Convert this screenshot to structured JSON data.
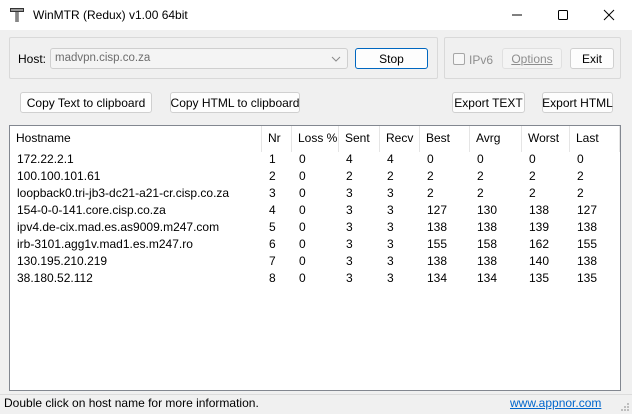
{
  "window": {
    "title": "WinMTR (Redux) v1.00 64bit"
  },
  "toolbar": {
    "host_label": "Host:",
    "host_value": "madvpn.cisp.co.za",
    "stop_label": "Stop",
    "ipv6_label": "IPv6",
    "ipv6_checked": false,
    "options_label": "Options",
    "exit_label": "Exit",
    "copy_text_label": "Copy Text to clipboard",
    "copy_html_label": "Copy HTML to clipboard",
    "export_text_label": "Export TEXT",
    "export_html_label": "Export HTML"
  },
  "table": {
    "columns": [
      "Hostname",
      "Nr",
      "Loss %",
      "Sent",
      "Recv",
      "Best",
      "Avrg",
      "Worst",
      "Last"
    ],
    "rows": [
      [
        "172.22.2.1",
        "1",
        "0",
        "4",
        "4",
        "0",
        "0",
        "0",
        "0"
      ],
      [
        "100.100.101.61",
        "2",
        "0",
        "2",
        "2",
        "2",
        "2",
        "2",
        "2"
      ],
      [
        "loopback0.tri-jb3-dc21-a21-cr.cisp.co.za",
        "3",
        "0",
        "3",
        "3",
        "2",
        "2",
        "2",
        "2"
      ],
      [
        "154-0-0-141.core.cisp.co.za",
        "4",
        "0",
        "3",
        "3",
        "127",
        "130",
        "138",
        "127"
      ],
      [
        "ipv4.de-cix.mad.es.as9009.m247.com",
        "5",
        "0",
        "3",
        "3",
        "138",
        "138",
        "139",
        "138"
      ],
      [
        "irb-3101.agg1v.mad1.es.m247.ro",
        "6",
        "0",
        "3",
        "3",
        "155",
        "158",
        "162",
        "155"
      ],
      [
        "130.195.210.219",
        "7",
        "0",
        "3",
        "3",
        "138",
        "138",
        "140",
        "138"
      ],
      [
        "38.180.52.112",
        "8",
        "0",
        "3",
        "3",
        "134",
        "134",
        "135",
        "135"
      ]
    ]
  },
  "status": {
    "message": "Double click on host name for more information.",
    "link": "www.appnor.com"
  },
  "colors": {
    "accent": "#0067c0",
    "link": "#0066cc"
  }
}
